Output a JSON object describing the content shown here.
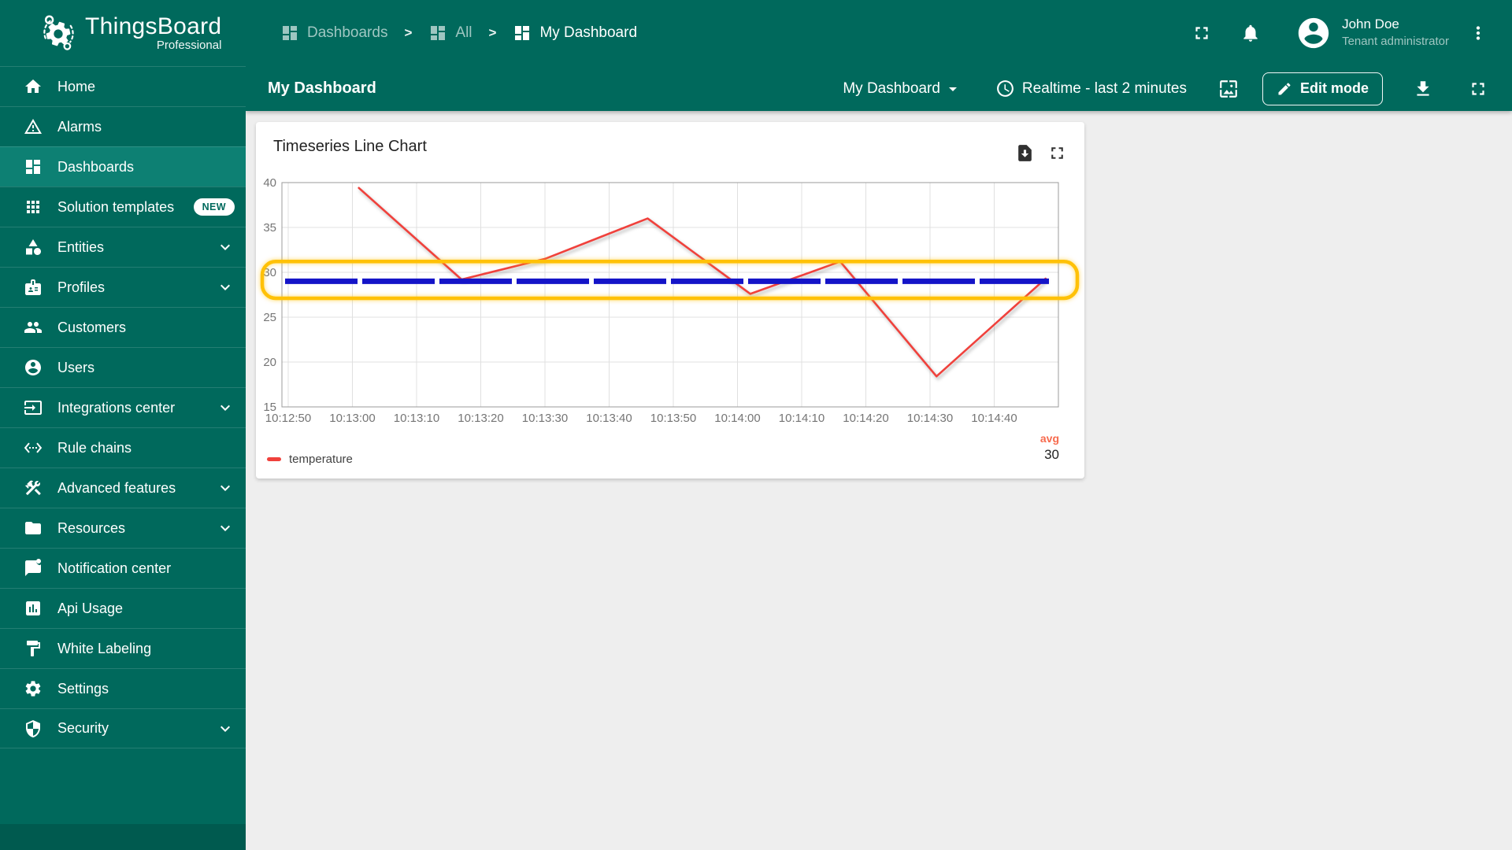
{
  "app": {
    "brand": "ThingsBoard",
    "brand_sub": "Professional",
    "logo_icon": "thingsboard-logo-icon"
  },
  "sidebar": {
    "items": [
      {
        "label": "Home",
        "icon": "home-icon"
      },
      {
        "label": "Alarms",
        "icon": "alarm-icon"
      },
      {
        "label": "Dashboards",
        "icon": "dashboards-icon",
        "active": true
      },
      {
        "label": "Solution templates",
        "icon": "solution-templates-icon",
        "badge": "NEW"
      },
      {
        "label": "Entities",
        "icon": "entities-icon",
        "expandable": true
      },
      {
        "label": "Profiles",
        "icon": "profiles-icon",
        "expandable": true
      },
      {
        "label": "Customers",
        "icon": "customers-icon"
      },
      {
        "label": "Users",
        "icon": "users-icon"
      },
      {
        "label": "Integrations center",
        "icon": "integrations-icon",
        "expandable": true
      },
      {
        "label": "Rule chains",
        "icon": "rule-chains-icon"
      },
      {
        "label": "Advanced features",
        "icon": "advanced-features-icon",
        "expandable": true
      },
      {
        "label": "Resources",
        "icon": "resources-icon",
        "expandable": true
      },
      {
        "label": "Notification center",
        "icon": "notification-icon"
      },
      {
        "label": "Api Usage",
        "icon": "api-usage-icon"
      },
      {
        "label": "White Labeling",
        "icon": "white-labeling-icon"
      },
      {
        "label": "Settings",
        "icon": "settings-icon"
      },
      {
        "label": "Security",
        "icon": "security-icon",
        "expandable": true
      }
    ]
  },
  "header": {
    "breadcrumbs": [
      {
        "label": "Dashboards",
        "icon": "dashboards-icon"
      },
      {
        "label": "All",
        "icon": "dashboards-icon"
      },
      {
        "label": "My Dashboard",
        "icon": "dashboards-icon"
      }
    ],
    "separator": ">",
    "icons": [
      "fullscreen-icon",
      "notifications-icon",
      "avatar",
      "more-vert-icon"
    ],
    "user": {
      "name": "John Doe",
      "role": "Tenant administrator"
    }
  },
  "toolbar": {
    "title": "My Dashboard",
    "dashboard_select": "My Dashboard",
    "time_window": "Realtime - last 2 minutes",
    "edit_button": "Edit mode",
    "icons": [
      "dropdown-caret-icon",
      "clock-icon",
      "wallpaper-icon",
      "edit-pencil-icon",
      "download-icon",
      "fullscreen-icon"
    ]
  },
  "widget": {
    "title": "Timeseries Line Chart",
    "action_icons": [
      "export-widget-icon",
      "expand-widget-icon"
    ],
    "legend": {
      "series_label": "temperature",
      "agg_label": "avg",
      "agg_value": "30"
    }
  },
  "chart_data": {
    "type": "line",
    "title": "Timeseries Line Chart",
    "x_ticks": [
      "10:12:50",
      "10:13:00",
      "10:13:10",
      "10:13:20",
      "10:13:30",
      "10:13:40",
      "10:13:50",
      "10:14:00",
      "10:14:10",
      "10:14:20",
      "10:14:30",
      "10:14:40"
    ],
    "x_range": [
      "10:12:50",
      "10:14:50"
    ],
    "ylim": [
      15,
      40
    ],
    "y_ticks": [
      15,
      20,
      25,
      30,
      35,
      40
    ],
    "grid": true,
    "legend_position": "bottom",
    "series": [
      {
        "name": "temperature",
        "color": "#f0413c",
        "points": [
          {
            "time": "10:13:01",
            "value": 39.4
          },
          {
            "time": "10:13:17",
            "value": 29.2
          },
          {
            "time": "10:13:30",
            "value": 31.5
          },
          {
            "time": "10:13:46",
            "value": 36.0
          },
          {
            "time": "10:14:02",
            "value": 27.6
          },
          {
            "time": "10:14:16",
            "value": 31.2
          },
          {
            "time": "10:14:31",
            "value": 18.4
          },
          {
            "time": "10:14:48",
            "value": 29.3
          }
        ],
        "avg": 30
      }
    ],
    "threshold": {
      "value": 29,
      "color": "#1414c8",
      "style": "dashed-thick"
    },
    "highlight_band": {
      "from": 27.1,
      "to": 31.2,
      "border_color": "#ffc107"
    }
  },
  "colors": {
    "sidebar_bg": "#00695c",
    "sidebar_active_bg": "#0d8073",
    "content_bg": "#eeeeee",
    "series_red": "#f0413c",
    "threshold_blue": "#1414c8",
    "band_amber": "#ffc107",
    "avg_label": "#f76a4d",
    "gridline": "#e0e0e0",
    "axis_text": "#757575"
  }
}
